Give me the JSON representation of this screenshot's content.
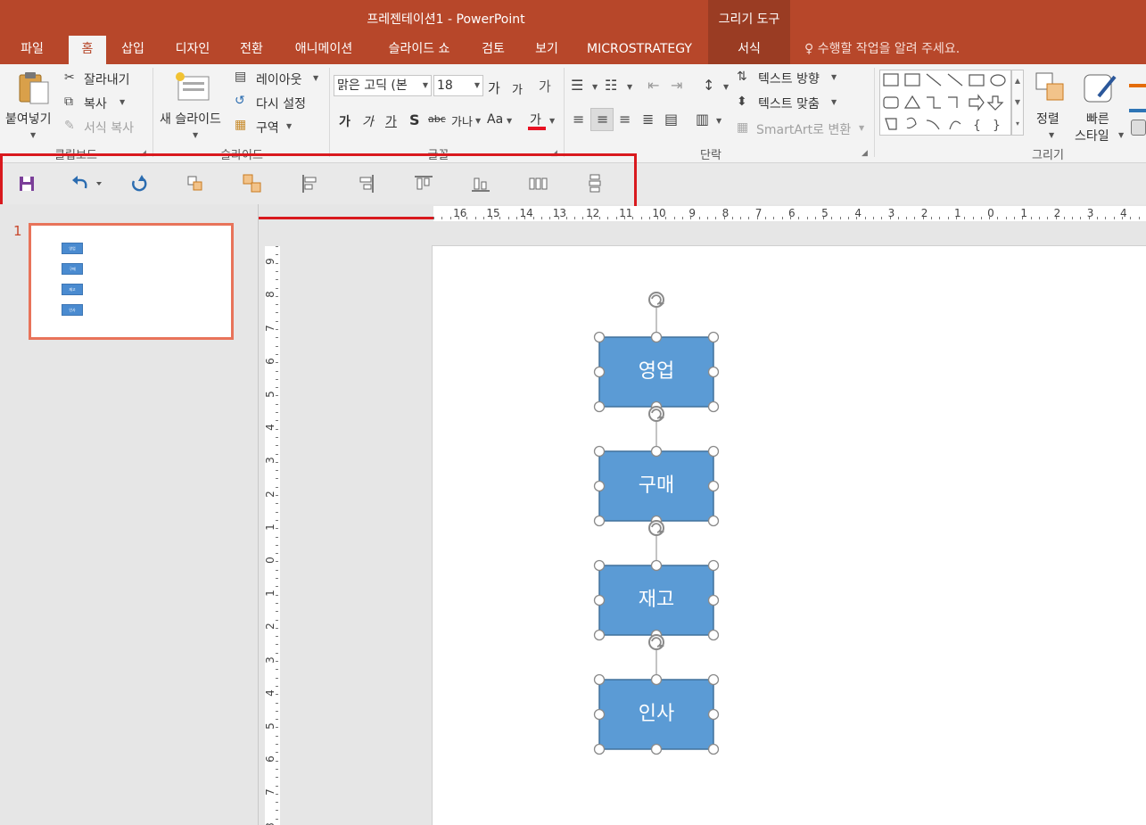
{
  "window": {
    "title": "프레젠테이션1 - PowerPoint",
    "context_group": "그리기 도구"
  },
  "tabs": [
    {
      "label": "파일"
    },
    {
      "label": "홈"
    },
    {
      "label": "삽입"
    },
    {
      "label": "디자인"
    },
    {
      "label": "전환"
    },
    {
      "label": "애니메이션"
    },
    {
      "label": "슬라이드 쇼"
    },
    {
      "label": "검토"
    },
    {
      "label": "보기"
    },
    {
      "label": "MICROSTRATEGY"
    },
    {
      "label": "서식"
    }
  ],
  "active_tab": "홈",
  "tell_me": "수행할 작업을 알려 주세요.",
  "ribbon": {
    "clipboard": {
      "paste": "붙여넣기",
      "cut": "잘라내기",
      "copy": "복사",
      "format_painter": "서식 복사",
      "label": "클립보드"
    },
    "slides": {
      "new_slide": "새 슬라이드",
      "layout": "레이아웃",
      "reset": "다시 설정",
      "section": "구역",
      "label": "슬라이드"
    },
    "font": {
      "font_name": "맑은 고딕 (본",
      "font_size": "18",
      "bold": "가",
      "italic": "가",
      "underline": "가",
      "shadow": "S",
      "strike": "abc",
      "spacing": "가나",
      "case": "Aa",
      "color": "가",
      "grow": "가",
      "shrink": "가",
      "clear": "가",
      "label": "글꼴"
    },
    "paragraph": {
      "text_direction": "텍스트 방향",
      "align_text": "텍스트 맞춤",
      "smartart": "SmartArt로 변환",
      "label": "단락"
    },
    "drawing": {
      "arrange": "정렬",
      "quick_styles_1": "빠른",
      "quick_styles_2": "스타일",
      "label": "그리기"
    }
  },
  "qat_icons": [
    "save-icon",
    "undo-icon",
    "redo-icon",
    "group-icon",
    "ungroup-icon",
    "align-left-icon",
    "align-right-icon",
    "align-top-icon",
    "align-bottom-icon",
    "distribute-horizontal-icon",
    "distribute-vertical-icon"
  ],
  "thumbnail": {
    "number": "1",
    "box_labels": [
      "영업",
      "구매",
      "재고",
      "인사"
    ]
  },
  "ruler": {
    "horizontal": [
      "16",
      "15",
      "14",
      "13",
      "12",
      "11",
      "10",
      "9",
      "8",
      "7",
      "6",
      "5",
      "4",
      "3",
      "2",
      "1",
      "0",
      "1",
      "2",
      "3",
      "4"
    ],
    "vertical": [
      "9",
      "8",
      "7",
      "6",
      "5",
      "4",
      "3",
      "2",
      "1",
      "0",
      "1",
      "2",
      "3",
      "4",
      "5",
      "6",
      "7",
      "8"
    ]
  },
  "slide": {
    "shapes": [
      "영업",
      "구매",
      "재고",
      "인사"
    ],
    "shape_fill": "#5b9bd5",
    "shape_border": "#41719c"
  },
  "colors": {
    "accent": "#b7472a",
    "highlight_box": "#d9191e",
    "font_color_bar": "#e81123"
  }
}
